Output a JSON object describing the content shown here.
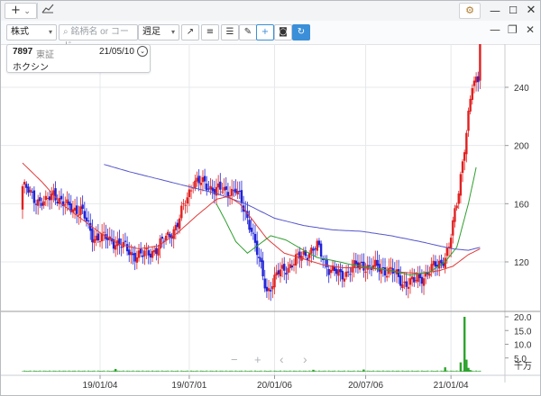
{
  "titlebar": {
    "add_label": "+",
    "add_chevron": "⌄",
    "icons": {
      "chart": "line-chart-icon",
      "settings": "gear-icon",
      "minimize": "minimize-icon",
      "maximize": "maximize-icon",
      "close": "close-icon"
    }
  },
  "toolbar": {
    "market_select": "株式",
    "search_placeholder": "銘柄名 or コード",
    "period_select": "週足",
    "tools": [
      "trend-line-icon",
      "text-left-icon",
      "text-right-icon",
      "pencil-icon",
      "crosshair-icon",
      "camera-icon",
      "refresh-icon"
    ]
  },
  "info": {
    "code": "7897",
    "exchange": "東証",
    "date": "21/05/10",
    "name": "ホクシン",
    "collapse_icon": "chevron-circle-icon"
  },
  "nav_controls": [
    "−",
    "+",
    "‹",
    "›"
  ],
  "colors": {
    "up": "#e02020",
    "down": "#1f22d6",
    "ma_short": "#2e9f2e",
    "ma_mid": "#e03a3a",
    "ma_long": "#5555cc",
    "volume": "#2ea32e"
  },
  "chart_data": {
    "type": "candlestick",
    "price_ticks": [
      "240",
      "200",
      "160",
      "120"
    ],
    "volume_ticks": [
      "20.0",
      "15.0",
      "10.0",
      "5.0"
    ],
    "volume_unit": "千万",
    "date_ticks": [
      "19/01/04",
      "19/07/01",
      "20/01/06",
      "20/07/06",
      "21/01/04"
    ],
    "ylim": [
      100,
      270
    ],
    "bounds": {
      "start": 156,
      "end": 274
    },
    "anchors": [
      [
        0,
        172
      ],
      [
        6,
        164
      ],
      [
        12,
        160
      ],
      [
        16,
        168
      ],
      [
        22,
        158
      ],
      [
        30,
        156
      ],
      [
        36,
        138
      ],
      [
        42,
        136
      ],
      [
        48,
        134
      ],
      [
        56,
        126
      ],
      [
        62,
        124
      ],
      [
        70,
        130
      ],
      [
        80,
        146
      ],
      [
        88,
        176
      ],
      [
        96,
        172
      ],
      [
        104,
        168
      ],
      [
        110,
        170
      ],
      [
        114,
        156
      ],
      [
        118,
        144
      ],
      [
        122,
        120
      ],
      [
        126,
        100
      ],
      [
        132,
        112
      ],
      [
        140,
        120
      ],
      [
        146,
        126
      ],
      [
        152,
        130
      ],
      [
        158,
        116
      ],
      [
        164,
        110
      ],
      [
        170,
        116
      ],
      [
        176,
        118
      ],
      [
        182,
        116
      ],
      [
        190,
        114
      ],
      [
        196,
        106
      ],
      [
        202,
        106
      ],
      [
        208,
        112
      ],
      [
        212,
        116
      ],
      [
        216,
        120
      ],
      [
        220,
        130
      ],
      [
        224,
        160
      ],
      [
        228,
        200
      ],
      [
        232,
        240
      ],
      [
        236,
        248
      ]
    ],
    "ma_short": [
      [
        100,
        160
      ],
      [
        104,
        150
      ],
      [
        110,
        134
      ],
      [
        116,
        126
      ],
      [
        122,
        132
      ],
      [
        128,
        138
      ],
      [
        136,
        135
      ],
      [
        145,
        128
      ],
      [
        152,
        123
      ],
      [
        160,
        121
      ],
      [
        170,
        118
      ],
      [
        180,
        116
      ],
      [
        190,
        114
      ],
      [
        200,
        111
      ],
      [
        210,
        113
      ],
      [
        218,
        120
      ],
      [
        224,
        130
      ],
      [
        230,
        160
      ],
      [
        234,
        185
      ]
    ],
    "ma_mid": [
      [
        0,
        188
      ],
      [
        10,
        175
      ],
      [
        20,
        160
      ],
      [
        30,
        150
      ],
      [
        40,
        140
      ],
      [
        50,
        132
      ],
      [
        60,
        129
      ],
      [
        70,
        131
      ],
      [
        80,
        140
      ],
      [
        90,
        152
      ],
      [
        100,
        163
      ],
      [
        106,
        165
      ],
      [
        112,
        160
      ],
      [
        118,
        150
      ],
      [
        126,
        136
      ],
      [
        135,
        126
      ],
      [
        145,
        122
      ],
      [
        155,
        118
      ],
      [
        165,
        116
      ],
      [
        175,
        116
      ],
      [
        185,
        115
      ],
      [
        195,
        113
      ],
      [
        205,
        112
      ],
      [
        215,
        114
      ],
      [
        222,
        117
      ],
      [
        230,
        125
      ],
      [
        236,
        129
      ]
    ],
    "ma_long": [
      [
        42,
        187
      ],
      [
        55,
        182
      ],
      [
        70,
        177
      ],
      [
        85,
        172
      ],
      [
        100,
        167
      ],
      [
        115,
        160
      ],
      [
        130,
        150
      ],
      [
        145,
        145
      ],
      [
        160,
        142
      ],
      [
        175,
        141
      ],
      [
        190,
        138
      ],
      [
        205,
        134
      ],
      [
        215,
        131
      ],
      [
        222,
        129
      ],
      [
        230,
        128
      ],
      [
        236,
        130
      ]
    ],
    "volumes": [
      [
        48,
        1.0
      ],
      [
        150,
        0.7
      ],
      [
        176,
        0.8
      ],
      [
        218,
        1.6
      ],
      [
        226,
        3.4
      ],
      [
        228,
        20.0
      ],
      [
        229,
        4.4
      ],
      [
        230,
        1.4
      ],
      [
        231,
        0.6
      ]
    ]
  }
}
